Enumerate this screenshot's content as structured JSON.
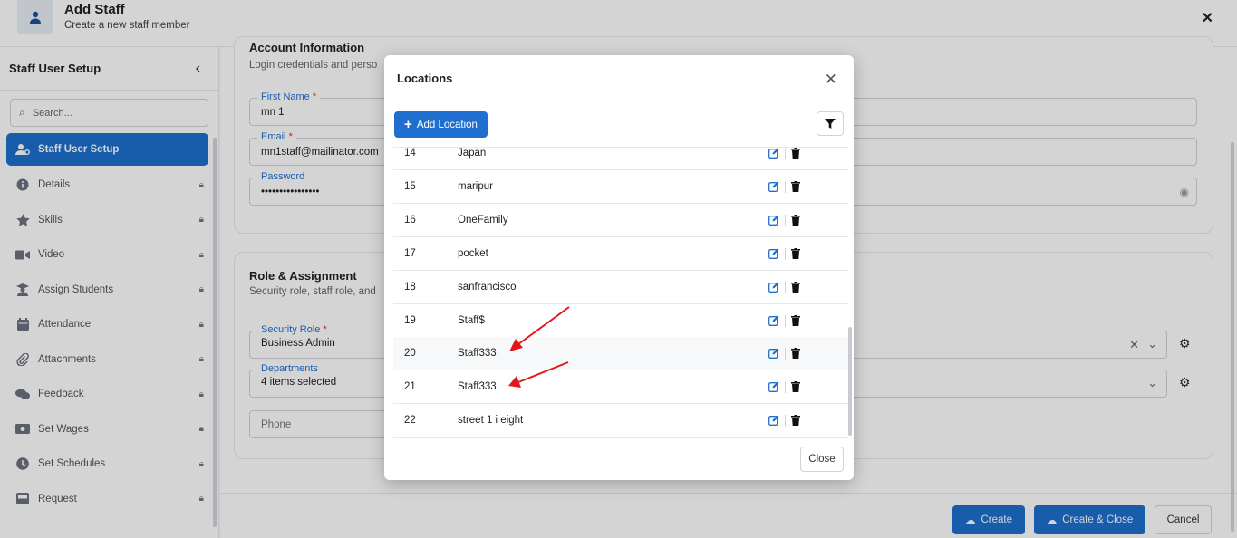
{
  "header": {
    "title": "Add Staff",
    "subtitle": "Create a new staff member",
    "avatar_icon": "user-icon",
    "close_icon": "close-icon"
  },
  "sidebar": {
    "title": "Staff User Setup",
    "search_placeholder": "Search...",
    "items": [
      {
        "label": "Staff User Setup",
        "icon": "user-gear-icon",
        "locked": false,
        "active": true
      },
      {
        "label": "Details",
        "icon": "info-icon",
        "locked": true
      },
      {
        "label": "Skills",
        "icon": "star-icon",
        "locked": true
      },
      {
        "label": "Video",
        "icon": "video-icon",
        "locked": true
      },
      {
        "label": "Assign Students",
        "icon": "student-icon",
        "locked": true
      },
      {
        "label": "Attendance",
        "icon": "calendar-icon",
        "locked": true
      },
      {
        "label": "Attachments",
        "icon": "paperclip-icon",
        "locked": true
      },
      {
        "label": "Feedback",
        "icon": "comments-icon",
        "locked": true
      },
      {
        "label": "Set Wages",
        "icon": "money-icon",
        "locked": true
      },
      {
        "label": "Set Schedules",
        "icon": "clock-icon",
        "locked": true
      },
      {
        "label": "Request",
        "icon": "inbox-icon",
        "locked": true
      }
    ]
  },
  "account": {
    "heading": "Account Information",
    "description": "Login credentials and perso",
    "first_name_label": "First Name",
    "first_name_value": "mn 1",
    "email_label": "Email",
    "email_value": "mn1staff@mailinator.com",
    "password_label": "Password",
    "password_value": "••••••••••••••••"
  },
  "role": {
    "heading": "Role & Assignment",
    "description": "Security role, staff role, and",
    "security_role_label": "Security Role",
    "security_role_value": "Business Admin",
    "departments_label": "Departments",
    "departments_value": "4 items selected",
    "phone_placeholder": "Phone"
  },
  "footer": {
    "create": "Create",
    "create_close": "Create & Close",
    "cancel": "Cancel"
  },
  "modal": {
    "title": "Locations",
    "add_label": "Add Location",
    "close_label": "Close",
    "rows": [
      {
        "id": "14",
        "name": "Japan"
      },
      {
        "id": "15",
        "name": "maripur"
      },
      {
        "id": "16",
        "name": "OneFamily"
      },
      {
        "id": "17",
        "name": "pocket"
      },
      {
        "id": "18",
        "name": "sanfrancisco"
      },
      {
        "id": "19",
        "name": "Staff$"
      },
      {
        "id": "20",
        "name": "Staff333"
      },
      {
        "id": "21",
        "name": "Staff333"
      },
      {
        "id": "22",
        "name": "street 1 i eight"
      }
    ]
  },
  "colors": {
    "accent": "#1e6fcf",
    "required": "#d92d20",
    "annotation_arrow": "#e3161b"
  }
}
